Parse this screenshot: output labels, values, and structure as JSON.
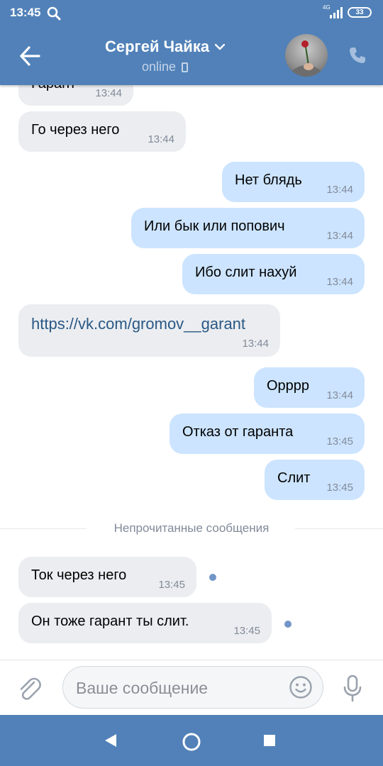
{
  "status": {
    "time": "13:45",
    "network": "4G",
    "battery": "33"
  },
  "header": {
    "name": "Сергей Чайка",
    "status": "online"
  },
  "messages": [
    {
      "dir": "in",
      "text": "Гарант",
      "time": "13:44"
    },
    {
      "dir": "in",
      "text": "Го через него",
      "time": "13:44"
    },
    {
      "dir": "out",
      "text": "Нет блядь",
      "time": "13:44"
    },
    {
      "dir": "out",
      "text": "Или бык или попович",
      "time": "13:44"
    },
    {
      "dir": "out",
      "text": "Ибо слит нахуй",
      "time": "13:44"
    },
    {
      "dir": "in",
      "text": "https://vk.com/gromov__garant",
      "time": "13:44"
    },
    {
      "dir": "out",
      "text": "Орррр",
      "time": "13:44"
    },
    {
      "dir": "out",
      "text": "Отказ от гаранта",
      "time": "13:45"
    },
    {
      "dir": "out",
      "text": "Слит",
      "time": "13:45"
    },
    {
      "dir": "in",
      "text": "Ток через него",
      "time": "13:45",
      "unread": true
    },
    {
      "dir": "in",
      "text": "Он тоже гарант ты слит.",
      "time": "13:45",
      "unread": true
    }
  ],
  "divider": {
    "label": "Непрочитанные сообщения"
  },
  "composer": {
    "placeholder": "Ваше сообщение"
  },
  "colors": {
    "header": "#5181b8",
    "incoming_bubble": "#ebedf0",
    "outgoing_bubble": "#cce4ff",
    "link": "#2a5885",
    "unread_dot": "#7196c7"
  }
}
